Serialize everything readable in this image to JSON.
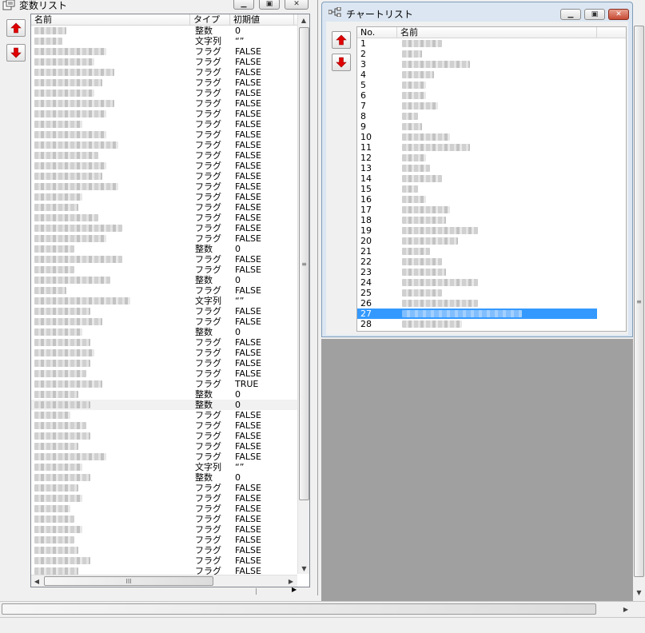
{
  "variable_window": {
    "title": "変数リスト",
    "columns": [
      "名前",
      "タイプ",
      "初期値"
    ],
    "rows": [
      {
        "type": "整数",
        "value": "0"
      },
      {
        "type": "文字列",
        "value": "“”"
      },
      {
        "type": "フラグ",
        "value": "FALSE"
      },
      {
        "type": "フラグ",
        "value": "FALSE"
      },
      {
        "type": "フラグ",
        "value": "FALSE"
      },
      {
        "type": "フラグ",
        "value": "FALSE"
      },
      {
        "type": "フラグ",
        "value": "FALSE"
      },
      {
        "type": "フラグ",
        "value": "FALSE"
      },
      {
        "type": "フラグ",
        "value": "FALSE"
      },
      {
        "type": "フラグ",
        "value": "FALSE"
      },
      {
        "type": "フラグ",
        "value": "FALSE"
      },
      {
        "type": "フラグ",
        "value": "FALSE"
      },
      {
        "type": "フラグ",
        "value": "FALSE"
      },
      {
        "type": "フラグ",
        "value": "FALSE"
      },
      {
        "type": "フラグ",
        "value": "FALSE"
      },
      {
        "type": "フラグ",
        "value": "FALSE"
      },
      {
        "type": "フラグ",
        "value": "FALSE"
      },
      {
        "type": "フラグ",
        "value": "FALSE"
      },
      {
        "type": "フラグ",
        "value": "FALSE"
      },
      {
        "type": "フラグ",
        "value": "FALSE"
      },
      {
        "type": "フラグ",
        "value": "FALSE"
      },
      {
        "type": "整数",
        "value": "0"
      },
      {
        "type": "フラグ",
        "value": "FALSE"
      },
      {
        "type": "フラグ",
        "value": "FALSE"
      },
      {
        "type": "整数",
        "value": "0"
      },
      {
        "type": "フラグ",
        "value": "FALSE"
      },
      {
        "type": "文字列",
        "value": "“”"
      },
      {
        "type": "フラグ",
        "value": "FALSE"
      },
      {
        "type": "フラグ",
        "value": "FALSE"
      },
      {
        "type": "整数",
        "value": "0"
      },
      {
        "type": "フラグ",
        "value": "FALSE"
      },
      {
        "type": "フラグ",
        "value": "FALSE"
      },
      {
        "type": "フラグ",
        "value": "FALSE"
      },
      {
        "type": "フラグ",
        "value": "FALSE"
      },
      {
        "type": "フラグ",
        "value": "TRUE"
      },
      {
        "type": "整数",
        "value": "0"
      },
      {
        "type": "整数",
        "value": "0",
        "highlighted": true
      },
      {
        "type": "フラグ",
        "value": "FALSE"
      },
      {
        "type": "フラグ",
        "value": "FALSE"
      },
      {
        "type": "フラグ",
        "value": "FALSE"
      },
      {
        "type": "フラグ",
        "value": "FALSE"
      },
      {
        "type": "フラグ",
        "value": "FALSE"
      },
      {
        "type": "文字列",
        "value": "“”"
      },
      {
        "type": "整数",
        "value": "0"
      },
      {
        "type": "フラグ",
        "value": "FALSE"
      },
      {
        "type": "フラグ",
        "value": "FALSE"
      },
      {
        "type": "フラグ",
        "value": "FALSE"
      },
      {
        "type": "フラグ",
        "value": "FALSE"
      },
      {
        "type": "フラグ",
        "value": "FALSE"
      },
      {
        "type": "フラグ",
        "value": "FALSE"
      },
      {
        "type": "フラグ",
        "value": "FALSE"
      },
      {
        "type": "フラグ",
        "value": "FALSE"
      },
      {
        "type": "フラグ",
        "value": "FALSE"
      }
    ],
    "hscroll_thumb_glyph": "III",
    "vscroll_thumb_glyph": "≡"
  },
  "chart_window": {
    "title": "チャートリスト",
    "columns": [
      "No.",
      "名前"
    ],
    "numbers": [
      "1",
      "2",
      "3",
      "4",
      "5",
      "6",
      "7",
      "8",
      "9",
      "10",
      "11",
      "12",
      "13",
      "14",
      "15",
      "16",
      "17",
      "18",
      "19",
      "20",
      "21",
      "22",
      "23",
      "24",
      "25",
      "26",
      "27",
      "28"
    ],
    "selected_number": "27"
  },
  "colors": {
    "selection": "#3399ff",
    "arrow_red": "#e00000",
    "workspace_gray": "#a0a0a0"
  },
  "icons": {
    "move_up": "up-arrow-icon",
    "move_down": "down-arrow-icon"
  }
}
